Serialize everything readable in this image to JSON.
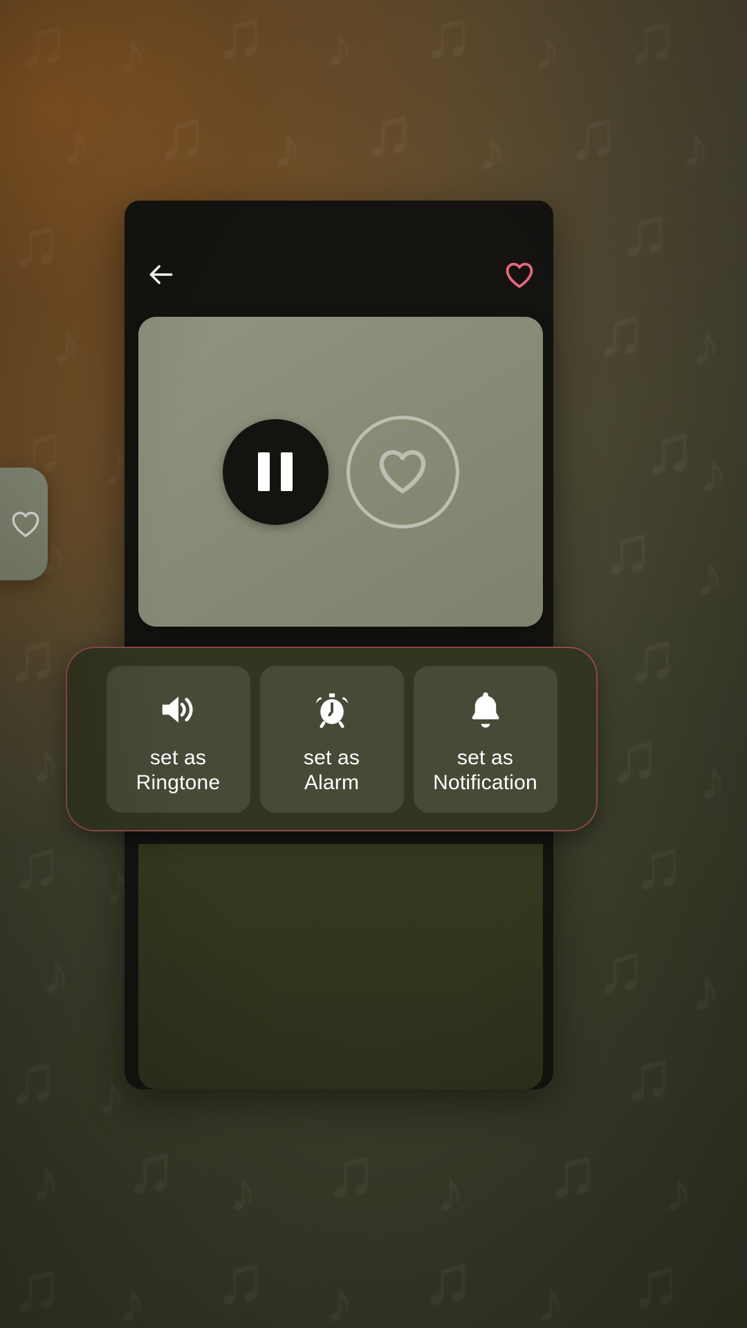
{
  "wallpaper": {
    "pattern_glyphs": [
      "♪",
      "♫",
      "♪",
      "♫"
    ],
    "accent_glow_color": "#b5712e",
    "base_color": "#4f4f3a"
  },
  "left_peek_card": {
    "name": "adjacent-song-card",
    "icon": "heart-outline-icon"
  },
  "player_card": {
    "background_color": "#141310",
    "top_bar": {
      "back_icon": "arrow-left-icon",
      "favorite_icon": "heart-outline-icon",
      "favorite_color": "#e8697f"
    },
    "panel": {
      "background_color": "#8a8f7a",
      "pause_button": {
        "icon": "pause-icon",
        "state": "playing",
        "background_color": "#141310"
      },
      "like_button": {
        "icon": "heart-outline-icon",
        "state": "not-liked",
        "border_color": "#bcc0b2"
      }
    }
  },
  "action_bar": {
    "border_color": "#8d4a4d",
    "background_color": "#32351f",
    "tiles": [
      {
        "icon": "volume-up-icon",
        "label": "set as\nRingtone"
      },
      {
        "icon": "alarm-clock-icon",
        "label": "set as\nAlarm"
      },
      {
        "icon": "bell-icon",
        "label": "set as\nNotification"
      }
    ]
  }
}
